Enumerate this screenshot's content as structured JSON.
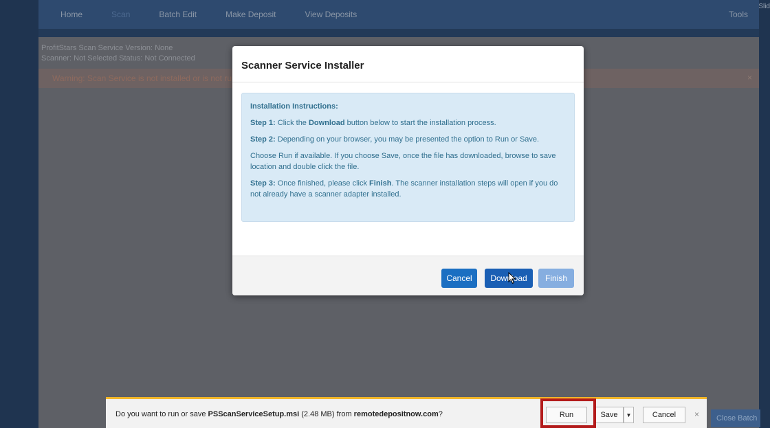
{
  "background": {
    "nav": {
      "items": [
        "Home",
        "Scan",
        "Batch Edit",
        "Make Deposit",
        "View Deposits"
      ],
      "tools": "Tools",
      "slide_tag": "Slid"
    },
    "status": {
      "line1": "ProfitStars Scan Service Version: None",
      "line2": "Scanner: Not Selected    Status: Not Connected"
    },
    "warning": "Warning: Scan Service is not installed or is not running. Install the scan service.",
    "warning_close": "×",
    "right_button": "Close Batch"
  },
  "modal": {
    "title": "Scanner Service Installer",
    "instructions": {
      "title": "Installation Instructions:",
      "step1_label": "Step 1:",
      "step1_pre": " Click the ",
      "step1_bold": "Download",
      "step1_post": " button below to start the installation process.",
      "step2_label": "Step 2:",
      "step2_text": " Depending on your browser, you may be presented the option to Run or Save.",
      "choose_text": "Choose Run if available. If you choose Save, once the file has downloaded, browse to save location and double click the file.",
      "step3_label": "Step 3:",
      "step3_pre": " Once finished, please click ",
      "step3_bold": "Finish",
      "step3_post": ". The scanner installation steps will open if you do not already have a scanner adapter installed."
    },
    "buttons": {
      "cancel": "Cancel",
      "download": "Download",
      "finish": "Finish"
    }
  },
  "download_bar": {
    "msg_pre": "Do you want to run or save ",
    "file": "PSScanServiceSetup.msi",
    "msg_mid": " (2.48 MB) from ",
    "site": "remotedepositnow.com",
    "msg_post": "?",
    "run": "Run",
    "save": "Save",
    "save_arrow": "▼",
    "cancel": "Cancel",
    "close": "×"
  },
  "colors": {
    "highlight_box": "#b31b1b",
    "download_bar_accent": "#f3b72a",
    "primary_button": "#1a5fb4"
  }
}
